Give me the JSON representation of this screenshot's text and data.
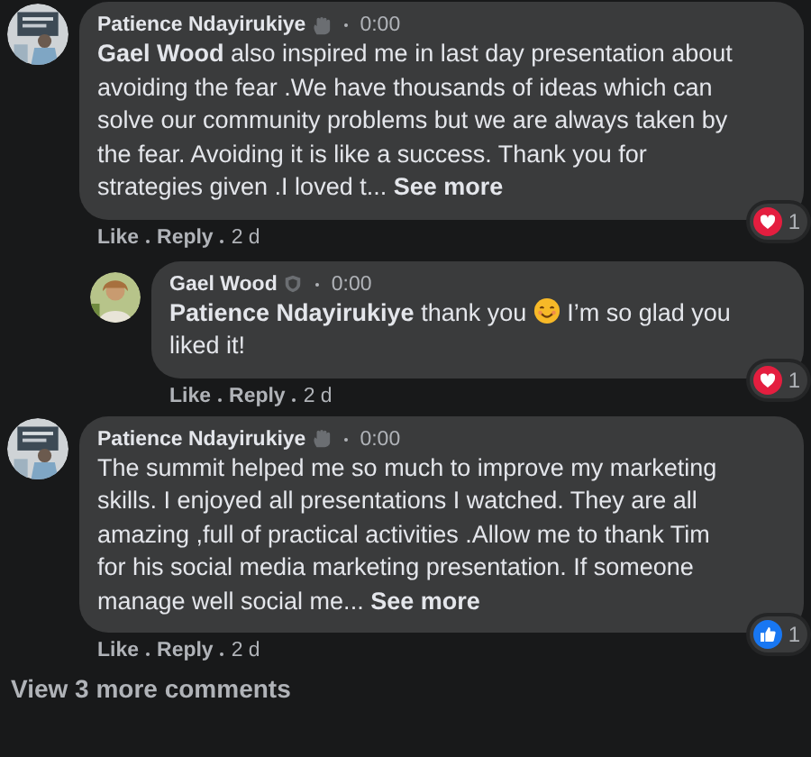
{
  "comments": [
    {
      "author": "Patience Ndayirukiye",
      "time": "0:00",
      "text": "**Gael Wood** also inspired me in last day presentation about avoiding the fear .We have thousands of ideas which can solve our community problems but we are always taken by the fear. Avoiding it is like a success. Thank you for strategies given .I loved t...",
      "see_more": "See more",
      "reaction": {
        "kind": "love",
        "count": "1"
      },
      "actions": [
        "Like",
        "Reply",
        "2 d"
      ],
      "replies": [
        {
          "author": "Gael Wood",
          "time": "0:00",
          "text": "**Patience Ndayirukiye** thank you",
          "emoji": true,
          "text_after": "I’m so glad you liked it!",
          "reaction": {
            "kind": "love",
            "count": "1"
          },
          "actions": [
            "Like",
            "Reply",
            "2 d"
          ]
        }
      ]
    },
    {
      "author": "Patience Ndayirukiye",
      "time": "0:00",
      "text": "The summit helped me so much to improve my marketing skills. I enjoyed all presentations I watched. They are all amazing ,full of practical activities .Allow me to thank Tim for his social media marketing presentation. If someone manage well social me...",
      "see_more": "See more",
      "reaction": {
        "kind": "like",
        "count": "1"
      },
      "actions": [
        "Like",
        "Reply",
        "2 d"
      ]
    }
  ],
  "view_more": "View 3 more comments"
}
